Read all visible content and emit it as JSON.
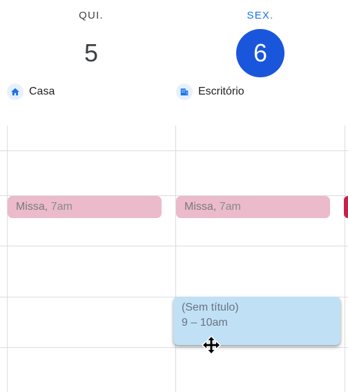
{
  "days": [
    {
      "dow": "QUI.",
      "date": "5",
      "is_today": false,
      "work_location": {
        "label": "Casa",
        "icon": "home-icon"
      }
    },
    {
      "dow": "SEX.",
      "date": "6",
      "is_today": true,
      "work_location": {
        "label": "Escritório",
        "icon": "office-building-icon"
      }
    }
  ],
  "events": [
    {
      "title": "Missa,",
      "time": "7am",
      "day": 0,
      "color": "#ebbacb"
    },
    {
      "title": "Missa,",
      "time": "7am",
      "day": 1,
      "color": "#ebbacb"
    }
  ],
  "draft_event": {
    "title": "(Sem título)",
    "time": "9 – 10am",
    "color": "#c0e0f5"
  },
  "colors": {
    "today_circle": "#1a56db",
    "today_dow": "#1a73e8",
    "peek_event": "#c5224a",
    "grid_line": "#dadce0"
  },
  "cursor": "move-cursor-icon"
}
